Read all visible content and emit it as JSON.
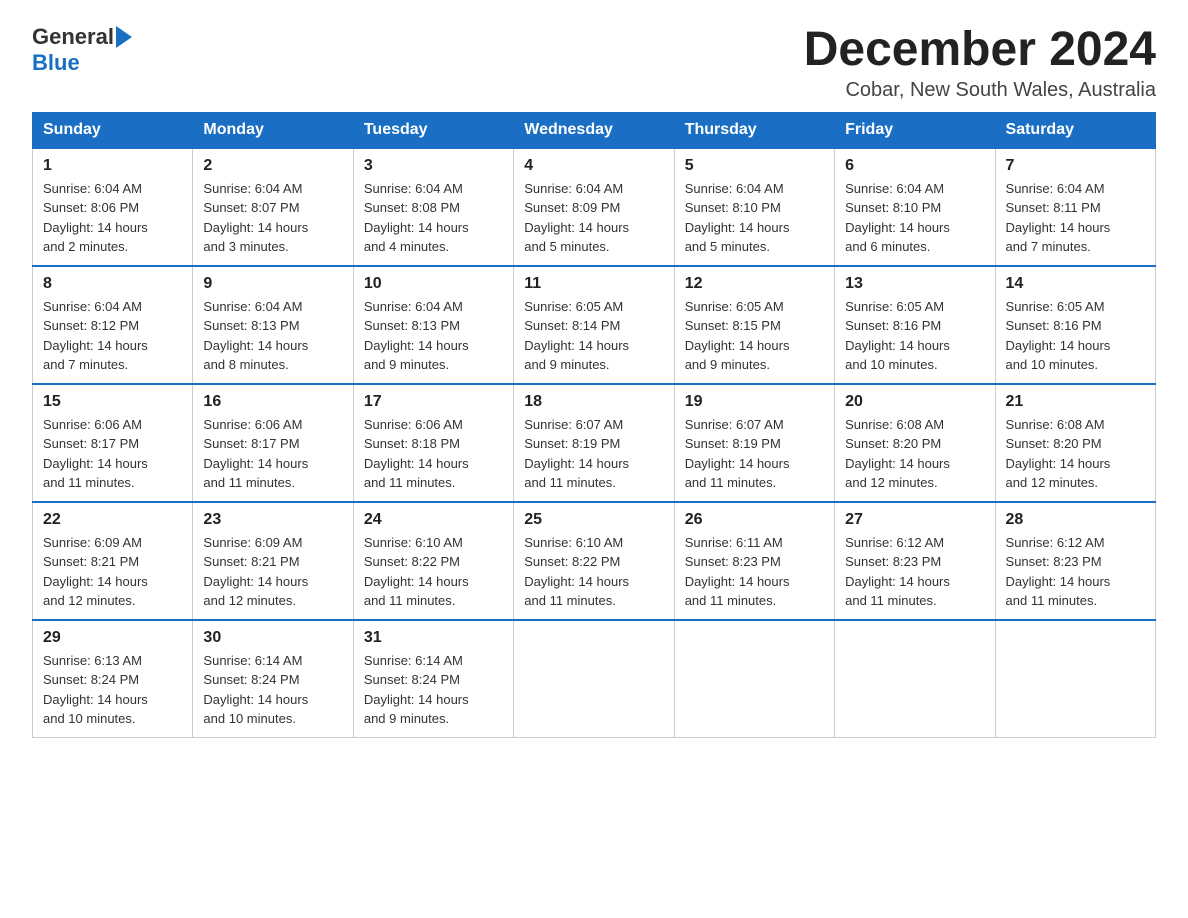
{
  "header": {
    "logo_general": "General",
    "logo_blue": "Blue",
    "month_year": "December 2024",
    "location": "Cobar, New South Wales, Australia"
  },
  "columns": [
    "Sunday",
    "Monday",
    "Tuesday",
    "Wednesday",
    "Thursday",
    "Friday",
    "Saturday"
  ],
  "weeks": [
    [
      {
        "day": "1",
        "sunrise": "6:04 AM",
        "sunset": "8:06 PM",
        "daylight": "14 hours and 2 minutes."
      },
      {
        "day": "2",
        "sunrise": "6:04 AM",
        "sunset": "8:07 PM",
        "daylight": "14 hours and 3 minutes."
      },
      {
        "day": "3",
        "sunrise": "6:04 AM",
        "sunset": "8:08 PM",
        "daylight": "14 hours and 4 minutes."
      },
      {
        "day": "4",
        "sunrise": "6:04 AM",
        "sunset": "8:09 PM",
        "daylight": "14 hours and 5 minutes."
      },
      {
        "day": "5",
        "sunrise": "6:04 AM",
        "sunset": "8:10 PM",
        "daylight": "14 hours and 5 minutes."
      },
      {
        "day": "6",
        "sunrise": "6:04 AM",
        "sunset": "8:10 PM",
        "daylight": "14 hours and 6 minutes."
      },
      {
        "day": "7",
        "sunrise": "6:04 AM",
        "sunset": "8:11 PM",
        "daylight": "14 hours and 7 minutes."
      }
    ],
    [
      {
        "day": "8",
        "sunrise": "6:04 AM",
        "sunset": "8:12 PM",
        "daylight": "14 hours and 7 minutes."
      },
      {
        "day": "9",
        "sunrise": "6:04 AM",
        "sunset": "8:13 PM",
        "daylight": "14 hours and 8 minutes."
      },
      {
        "day": "10",
        "sunrise": "6:04 AM",
        "sunset": "8:13 PM",
        "daylight": "14 hours and 9 minutes."
      },
      {
        "day": "11",
        "sunrise": "6:05 AM",
        "sunset": "8:14 PM",
        "daylight": "14 hours and 9 minutes."
      },
      {
        "day": "12",
        "sunrise": "6:05 AM",
        "sunset": "8:15 PM",
        "daylight": "14 hours and 9 minutes."
      },
      {
        "day": "13",
        "sunrise": "6:05 AM",
        "sunset": "8:16 PM",
        "daylight": "14 hours and 10 minutes."
      },
      {
        "day": "14",
        "sunrise": "6:05 AM",
        "sunset": "8:16 PM",
        "daylight": "14 hours and 10 minutes."
      }
    ],
    [
      {
        "day": "15",
        "sunrise": "6:06 AM",
        "sunset": "8:17 PM",
        "daylight": "14 hours and 11 minutes."
      },
      {
        "day": "16",
        "sunrise": "6:06 AM",
        "sunset": "8:17 PM",
        "daylight": "14 hours and 11 minutes."
      },
      {
        "day": "17",
        "sunrise": "6:06 AM",
        "sunset": "8:18 PM",
        "daylight": "14 hours and 11 minutes."
      },
      {
        "day": "18",
        "sunrise": "6:07 AM",
        "sunset": "8:19 PM",
        "daylight": "14 hours and 11 minutes."
      },
      {
        "day": "19",
        "sunrise": "6:07 AM",
        "sunset": "8:19 PM",
        "daylight": "14 hours and 11 minutes."
      },
      {
        "day": "20",
        "sunrise": "6:08 AM",
        "sunset": "8:20 PM",
        "daylight": "14 hours and 12 minutes."
      },
      {
        "day": "21",
        "sunrise": "6:08 AM",
        "sunset": "8:20 PM",
        "daylight": "14 hours and 12 minutes."
      }
    ],
    [
      {
        "day": "22",
        "sunrise": "6:09 AM",
        "sunset": "8:21 PM",
        "daylight": "14 hours and 12 minutes."
      },
      {
        "day": "23",
        "sunrise": "6:09 AM",
        "sunset": "8:21 PM",
        "daylight": "14 hours and 12 minutes."
      },
      {
        "day": "24",
        "sunrise": "6:10 AM",
        "sunset": "8:22 PM",
        "daylight": "14 hours and 11 minutes."
      },
      {
        "day": "25",
        "sunrise": "6:10 AM",
        "sunset": "8:22 PM",
        "daylight": "14 hours and 11 minutes."
      },
      {
        "day": "26",
        "sunrise": "6:11 AM",
        "sunset": "8:23 PM",
        "daylight": "14 hours and 11 minutes."
      },
      {
        "day": "27",
        "sunrise": "6:12 AM",
        "sunset": "8:23 PM",
        "daylight": "14 hours and 11 minutes."
      },
      {
        "day": "28",
        "sunrise": "6:12 AM",
        "sunset": "8:23 PM",
        "daylight": "14 hours and 11 minutes."
      }
    ],
    [
      {
        "day": "29",
        "sunrise": "6:13 AM",
        "sunset": "8:24 PM",
        "daylight": "14 hours and 10 minutes."
      },
      {
        "day": "30",
        "sunrise": "6:14 AM",
        "sunset": "8:24 PM",
        "daylight": "14 hours and 10 minutes."
      },
      {
        "day": "31",
        "sunrise": "6:14 AM",
        "sunset": "8:24 PM",
        "daylight": "14 hours and 9 minutes."
      },
      null,
      null,
      null,
      null
    ]
  ],
  "labels": {
    "sunrise": "Sunrise:",
    "sunset": "Sunset:",
    "daylight": "Daylight:"
  }
}
